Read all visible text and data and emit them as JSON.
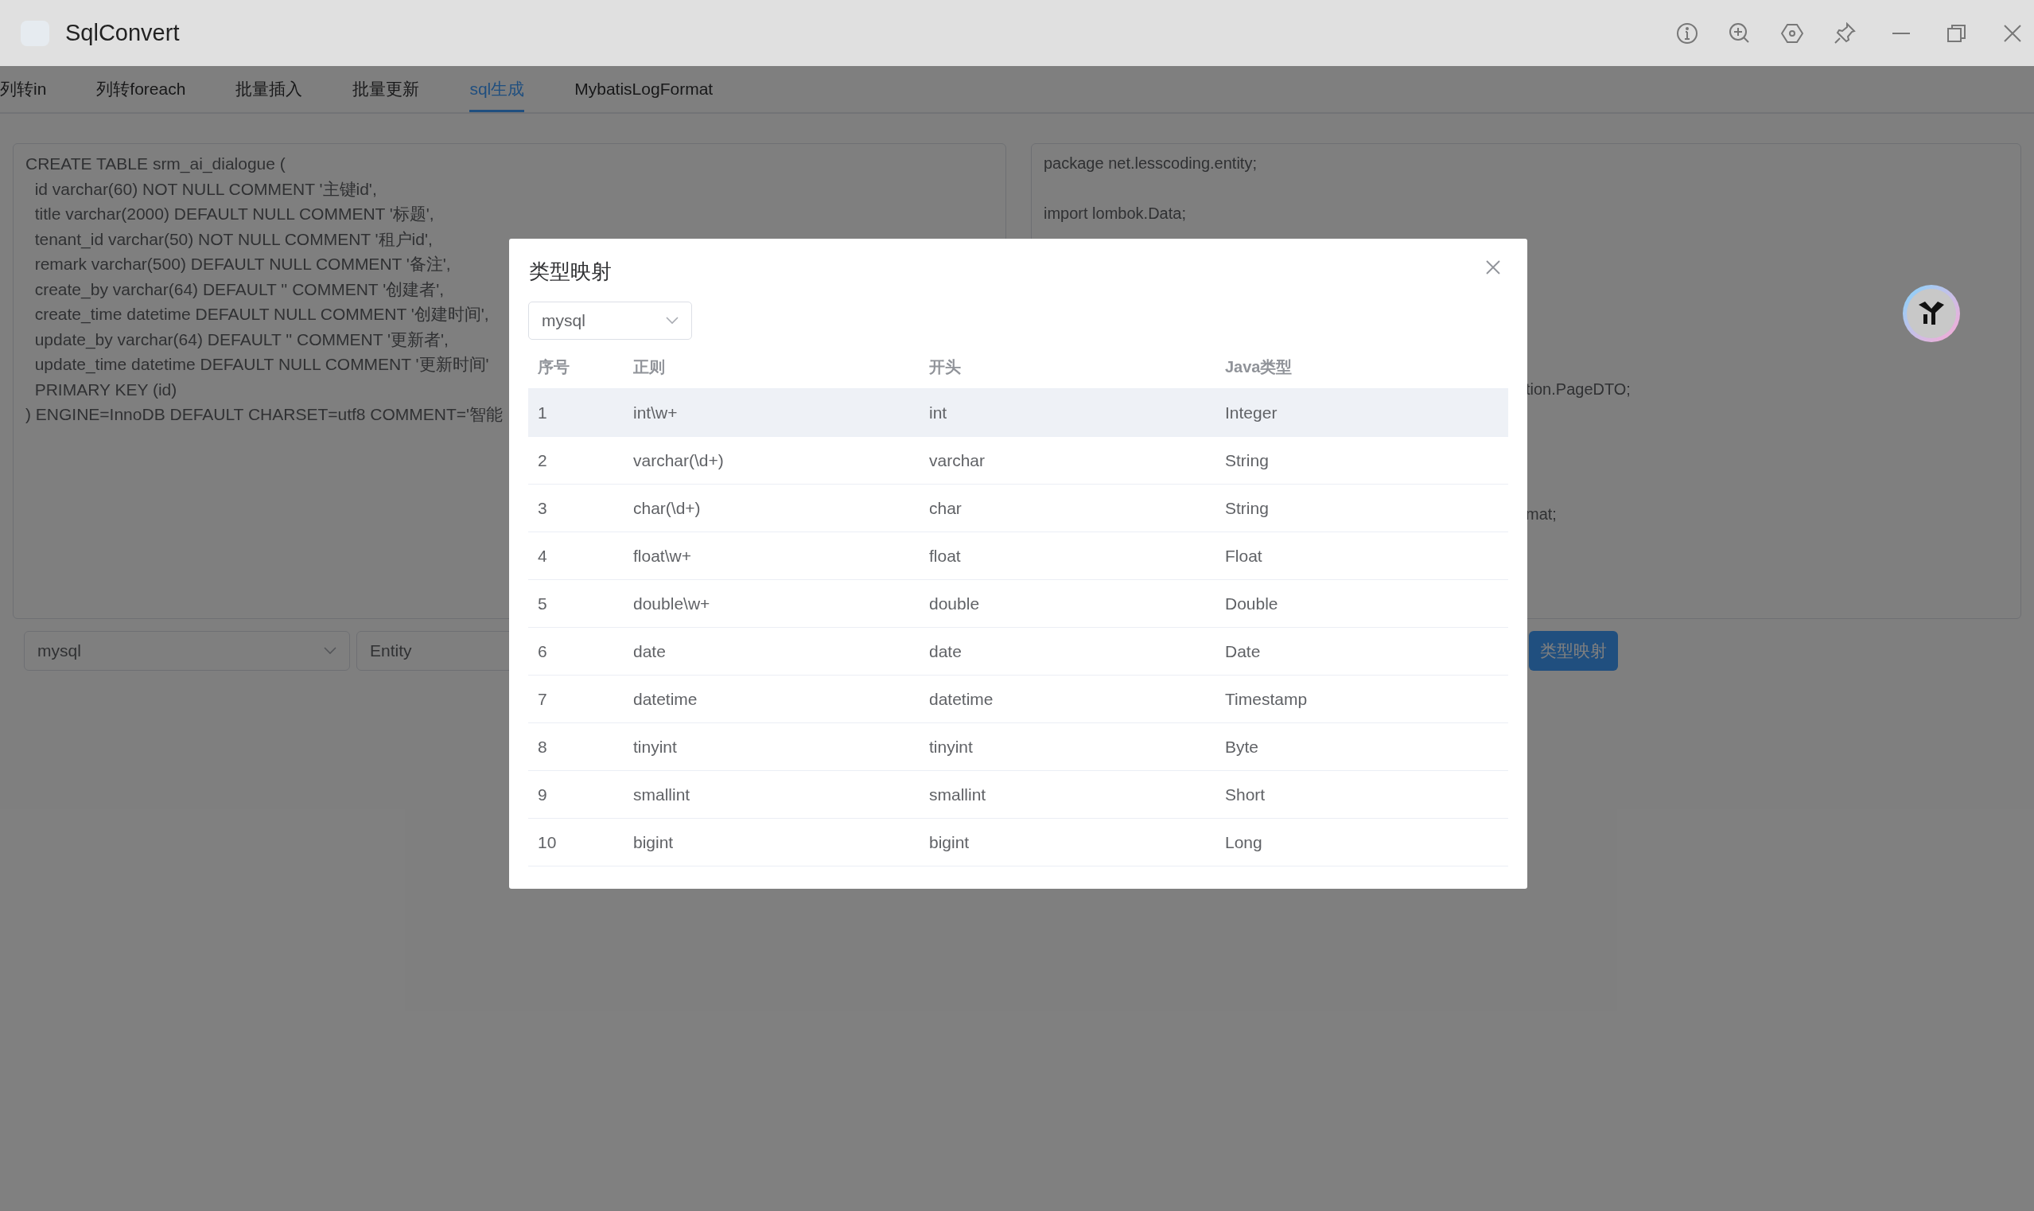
{
  "window": {
    "title": "SqlConvert"
  },
  "tabs": [
    {
      "label": "列转in",
      "selected": false
    },
    {
      "label": "列转foreach",
      "selected": false
    },
    {
      "label": "批量插入",
      "selected": false
    },
    {
      "label": "批量更新",
      "selected": false
    },
    {
      "label": "sql生成",
      "selected": true
    },
    {
      "label": "MybatisLogFormat",
      "selected": false
    }
  ],
  "sql_input": {
    "lines": [
      "CREATE TABLE srm_ai_dialogue (",
      "  id varchar(60) NOT NULL COMMENT '主键id',",
      "  title varchar(2000) DEFAULT NULL COMMENT '标题',",
      "  tenant_id varchar(50) NOT NULL COMMENT '租户id',",
      "  remark varchar(500) DEFAULT NULL COMMENT '备注',",
      "  create_by varchar(64) DEFAULT '' COMMENT '创建者',",
      "  create_time datetime DEFAULT NULL COMMENT '创建时间',",
      "  update_by varchar(64) DEFAULT '' COMMENT '更新者',",
      "  update_time datetime DEFAULT NULL COMMENT '更新时间'",
      "  PRIMARY KEY (id)",
      ") ENGINE=InnoDB DEFAULT CHARSET=utf8 COMMENT='智能"
    ]
  },
  "code_output": {
    "top_lines": [
      "package net.lesscoding.entity;",
      "import lombok.Data;"
    ],
    "fragments": [
      "tion.PageDTO;",
      "mat;"
    ]
  },
  "options": {
    "database": "mysql",
    "type": "Entity",
    "mapping_button": "类型映射"
  },
  "dialog": {
    "title": "类型映射",
    "database": "mysql",
    "columns": [
      "序号",
      "正则",
      "开头",
      "Java类型"
    ],
    "rows": [
      {
        "cells": [
          "1",
          "int\\w+",
          "int",
          "Integer"
        ],
        "highlighted": true
      },
      {
        "cells": [
          "2",
          "varchar(\\d+)",
          "varchar",
          "String"
        ],
        "highlighted": false
      },
      {
        "cells": [
          "3",
          "char(\\d+)",
          "char",
          "String"
        ],
        "highlighted": false
      },
      {
        "cells": [
          "4",
          "float\\w+",
          "float",
          "Float"
        ],
        "highlighted": false
      },
      {
        "cells": [
          "5",
          "double\\w+",
          "double",
          "Double"
        ],
        "highlighted": false
      },
      {
        "cells": [
          "6",
          "date",
          "date",
          "Date"
        ],
        "highlighted": false
      },
      {
        "cells": [
          "7",
          "datetime",
          "datetime",
          "Timestamp"
        ],
        "highlighted": false
      },
      {
        "cells": [
          "8",
          "tinyint",
          "tinyint",
          "Byte"
        ],
        "highlighted": false
      },
      {
        "cells": [
          "9",
          "smallint",
          "smallint",
          "Short"
        ],
        "highlighted": false
      },
      {
        "cells": [
          "10",
          "bigint",
          "bigint",
          "Long"
        ],
        "highlighted": false
      }
    ]
  }
}
